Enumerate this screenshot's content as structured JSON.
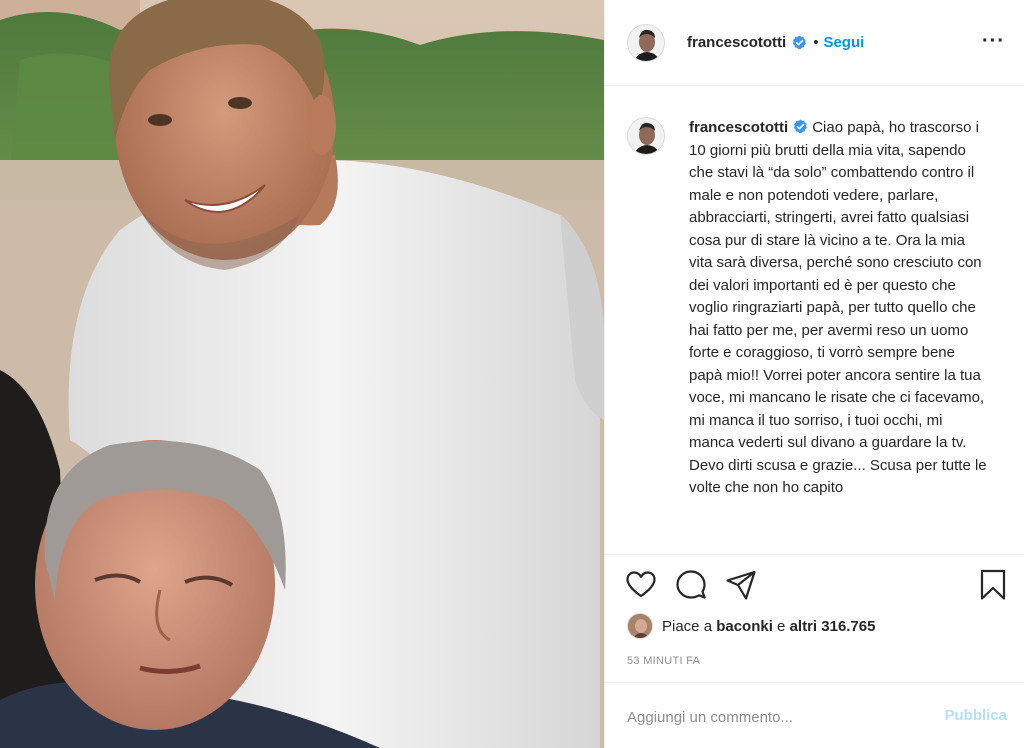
{
  "post": {
    "username": "francescototti",
    "follow_label": "Segui",
    "separator": "•",
    "more_label": "···",
    "photo_description": "Francesco Totti in white t-shirt with his father"
  },
  "caption": {
    "username": "francescototti",
    "text": "Ciao papà, ho trascorso i 10 giorni più brutti della mia vita, sapendo che stavi là “da solo” combattendo contro il male e non potendoti vedere, parlare, abbracciarti, stringerti, avrei fatto qualsiasi cosa pur di stare là vicino a te. Ora la mia vita sarà diversa, perché sono cresciuto con dei valori importanti ed è per questo che voglio ringraziarti papà, per tutto quello che hai fatto per me, per avermi reso un uomo forte e coraggioso, ti vorrò sempre bene papà mio!! Vorrei poter ancora sentire la tua voce, mi mancano le risate che ci facevamo, mi manca il tuo sorriso, i tuoi occhi, mi manca vederti sul divano a guardare la tv. Devo dirti scusa e grazie... Scusa per tutte le volte che non ho capito"
  },
  "likes": {
    "prefix": "Piace a ",
    "user": "baconki",
    "middle": " e ",
    "others": "altri 316.765"
  },
  "timestamp": "53 MINUTI FA",
  "comment": {
    "placeholder": "Aggiungi un commento...",
    "publish_label": "Pubblica"
  },
  "icons": {
    "like": "heart-icon",
    "comment": "comment-bubble-icon",
    "share": "paper-plane-icon",
    "save": "bookmark-icon",
    "verified": "verified-badge-icon",
    "more": "more-options-icon"
  },
  "colors": {
    "accent": "#0095f6",
    "verified": "#3897f0",
    "publish_disabled": "#b2dffc",
    "muted": "#8e8e8e",
    "text": "#262626",
    "border": "#efefef"
  }
}
